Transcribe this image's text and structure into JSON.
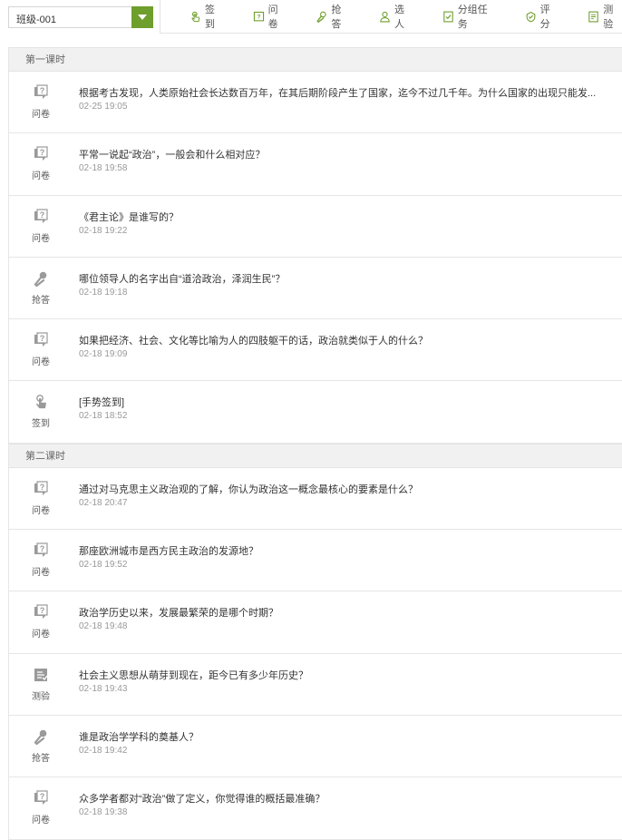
{
  "class_select": {
    "value": "班级-001"
  },
  "toolbar": [
    {
      "label": "签到",
      "icon": "hand-sign-in-icon"
    },
    {
      "label": "问卷",
      "icon": "questionnaire-icon"
    },
    {
      "label": "抢答",
      "icon": "microphone-icon"
    },
    {
      "label": "选人",
      "icon": "person-icon"
    },
    {
      "label": "分组任务",
      "icon": "group-task-icon"
    },
    {
      "label": "评分",
      "icon": "rating-icon"
    },
    {
      "label": "测验",
      "icon": "quiz-icon"
    }
  ],
  "sections": [
    {
      "title": "第一课时",
      "items": [
        {
          "type": "问卷",
          "icon": "questionnaire-icon",
          "title": "根据考古发现，人类原始社会长达数百万年，在其后期阶段产生了国家，迄今不过几千年。为什么国家的出现只能发...",
          "time": "02-25 19:05"
        },
        {
          "type": "问卷",
          "icon": "questionnaire-icon",
          "title": "平常一说起“政治”，一般会和什么相对应？",
          "time": "02-18 19:58"
        },
        {
          "type": "问卷",
          "icon": "questionnaire-icon",
          "title": "《君主论》是谁写的？",
          "time": "02-18 19:22"
        },
        {
          "type": "抢答",
          "icon": "microphone-icon",
          "title": "哪位领导人的名字出自“道洽政治，泽润生民”？",
          "time": "02-18 19:18"
        },
        {
          "type": "问卷",
          "icon": "questionnaire-icon",
          "title": "如果把经济、社会、文化等比喻为人的四肢躯干的话，政治就类似于人的什么？",
          "time": "02-18 19:09"
        },
        {
          "type": "签到",
          "icon": "hand-sign-in-icon",
          "title": "[手势签到]",
          "time": "02-18 18:52"
        }
      ]
    },
    {
      "title": "第二课时",
      "items": [
        {
          "type": "问卷",
          "icon": "questionnaire-icon",
          "title": "通过对马克思主义政治观的了解，你认为政治这一概念最核心的要素是什么？",
          "time": "02-18 20:47"
        },
        {
          "type": "问卷",
          "icon": "questionnaire-icon",
          "title": "那座欧洲城市是西方民主政治的发源地？",
          "time": "02-18 19:52"
        },
        {
          "type": "问卷",
          "icon": "questionnaire-icon",
          "title": "政治学历史以来，发展最繁荣的是哪个时期？",
          "time": "02-18 19:48"
        },
        {
          "type": "测验",
          "icon": "quiz-icon",
          "title": "社会主义思想从萌芽到现在，距今已有多少年历史？",
          "time": "02-18 19:43"
        },
        {
          "type": "抢答",
          "icon": "microphone-icon",
          "title": "谁是政治学学科的奠基人？",
          "time": "02-18 19:42"
        },
        {
          "type": "问卷",
          "icon": "questionnaire-icon",
          "title": "众多学者都对“政治”做了定义，你觉得谁的概括最准确？",
          "time": "02-18 19:38"
        }
      ]
    }
  ]
}
